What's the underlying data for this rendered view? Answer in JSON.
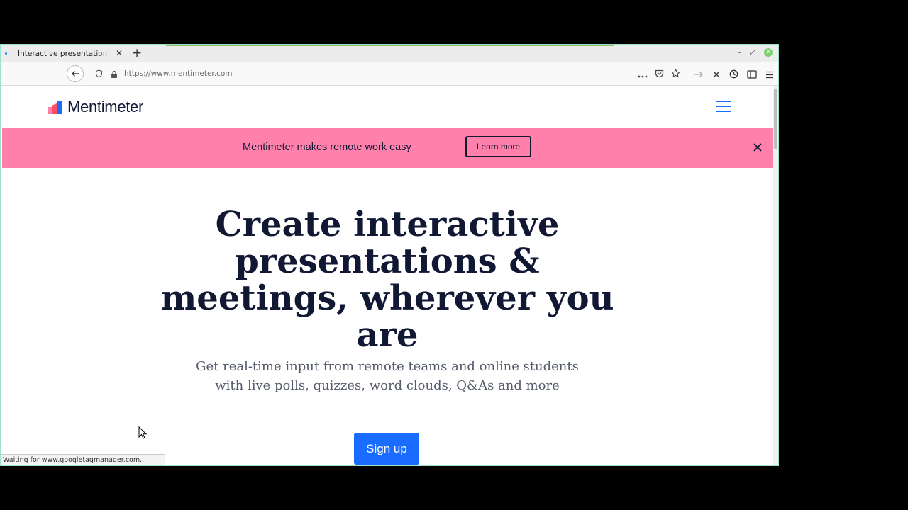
{
  "browser": {
    "tab_title": "Interactive presentation so",
    "new_tab_label": "+",
    "url": "https://www.mentimeter.com",
    "status_text": "Waiting for www.googletagmanager.com..."
  },
  "site": {
    "logo_text": "Mentimeter",
    "banner": {
      "text": "Mentimeter makes remote work easy",
      "button_label": "Learn more"
    },
    "hero": {
      "title": "Create interactive presentations & meetings, wherever you are",
      "subtitle": "Get real-time input from remote teams and online students with live polls, quizzes, word clouds, Q&As and more",
      "cta_label": "Sign up"
    }
  },
  "colors": {
    "banner_bg": "#ff80ab",
    "brand_blue": "#196cff",
    "text_dark": "#101834"
  },
  "icons": [
    "back-arrow-icon",
    "shield-icon",
    "lock-icon",
    "more-icon",
    "pocket-icon",
    "bookmark-star-icon",
    "forward-icon",
    "stop-icon",
    "history-icon",
    "sidebar-icon",
    "menu-icon",
    "hamburger-icon",
    "close-icon",
    "cursor-icon"
  ]
}
